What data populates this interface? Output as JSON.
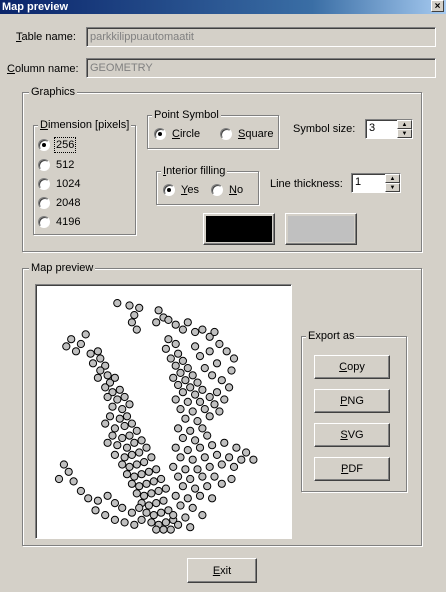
{
  "window": {
    "title": "Map preview",
    "close_glyph": "×"
  },
  "table": {
    "label_accel": "T",
    "label_rest": "able name:",
    "value": "parkkilippuautomaatit"
  },
  "column": {
    "label_accel": "C",
    "label_rest": "olumn name:",
    "value": "GEOMETRY"
  },
  "graphics": {
    "legend": "Graphics",
    "dimension": {
      "legend_accel": "D",
      "legend_rest": "imension [pixels]",
      "options": [
        {
          "label": "256",
          "checked": true
        },
        {
          "label": "512",
          "checked": false
        },
        {
          "label": "1024",
          "checked": false
        },
        {
          "label": "2048",
          "checked": false
        },
        {
          "label": "4196",
          "checked": false
        }
      ]
    },
    "point_symbol": {
      "legend": "Point Symbol",
      "options": [
        {
          "accel": "C",
          "rest": "ircle",
          "checked": true
        },
        {
          "accel": "S",
          "rest": "quare",
          "checked": false
        }
      ]
    },
    "symbol_size": {
      "label": "Symbol size:",
      "value": "3"
    },
    "interior_filling": {
      "legend_accel": "I",
      "legend_rest": "nterior filling",
      "options": [
        {
          "accel": "Y",
          "rest": "es",
          "checked": true
        },
        {
          "accel": "N",
          "rest": "o",
          "checked": false
        }
      ]
    },
    "line_thickness": {
      "label": "Line thickness:",
      "value": "1"
    },
    "colors": {
      "line_color": "#000000",
      "fill_color": "#c0c0c0"
    }
  },
  "preview": {
    "legend": "Map preview",
    "points": [
      [
        0.31,
        0.05
      ],
      [
        0.36,
        0.06
      ],
      [
        0.4,
        0.07
      ],
      [
        0.38,
        0.1
      ],
      [
        0.37,
        0.13
      ],
      [
        0.39,
        0.16
      ],
      [
        0.48,
        0.08
      ],
      [
        0.5,
        0.11
      ],
      [
        0.47,
        0.13
      ],
      [
        0.52,
        0.12
      ],
      [
        0.55,
        0.14
      ],
      [
        0.58,
        0.16
      ],
      [
        0.6,
        0.13
      ],
      [
        0.63,
        0.17
      ],
      [
        0.66,
        0.16
      ],
      [
        0.69,
        0.19
      ],
      [
        0.71,
        0.17
      ],
      [
        0.12,
        0.2
      ],
      [
        0.1,
        0.23
      ],
      [
        0.16,
        0.22
      ],
      [
        0.18,
        0.18
      ],
      [
        0.14,
        0.25
      ],
      [
        0.2,
        0.26
      ],
      [
        0.23,
        0.25
      ],
      [
        0.24,
        0.28
      ],
      [
        0.21,
        0.3
      ],
      [
        0.26,
        0.31
      ],
      [
        0.24,
        0.33
      ],
      [
        0.27,
        0.35
      ],
      [
        0.23,
        0.36
      ],
      [
        0.28,
        0.38
      ],
      [
        0.3,
        0.36
      ],
      [
        0.26,
        0.4
      ],
      [
        0.29,
        0.42
      ],
      [
        0.32,
        0.41
      ],
      [
        0.27,
        0.44
      ],
      [
        0.31,
        0.45
      ],
      [
        0.34,
        0.44
      ],
      [
        0.29,
        0.48
      ],
      [
        0.33,
        0.49
      ],
      [
        0.36,
        0.47
      ],
      [
        0.28,
        0.52
      ],
      [
        0.32,
        0.53
      ],
      [
        0.35,
        0.52
      ],
      [
        0.26,
        0.55
      ],
      [
        0.3,
        0.57
      ],
      [
        0.34,
        0.56
      ],
      [
        0.37,
        0.55
      ],
      [
        0.29,
        0.6
      ],
      [
        0.33,
        0.61
      ],
      [
        0.36,
        0.6
      ],
      [
        0.39,
        0.58
      ],
      [
        0.27,
        0.63
      ],
      [
        0.31,
        0.64
      ],
      [
        0.35,
        0.65
      ],
      [
        0.38,
        0.63
      ],
      [
        0.41,
        0.62
      ],
      [
        0.3,
        0.68
      ],
      [
        0.34,
        0.69
      ],
      [
        0.37,
        0.68
      ],
      [
        0.4,
        0.67
      ],
      [
        0.43,
        0.65
      ],
      [
        0.33,
        0.72
      ],
      [
        0.36,
        0.73
      ],
      [
        0.39,
        0.72
      ],
      [
        0.42,
        0.71
      ],
      [
        0.45,
        0.69
      ],
      [
        0.35,
        0.76
      ],
      [
        0.38,
        0.77
      ],
      [
        0.41,
        0.76
      ],
      [
        0.44,
        0.75
      ],
      [
        0.47,
        0.74
      ],
      [
        0.37,
        0.8
      ],
      [
        0.4,
        0.81
      ],
      [
        0.43,
        0.8
      ],
      [
        0.46,
        0.79
      ],
      [
        0.49,
        0.78
      ],
      [
        0.39,
        0.84
      ],
      [
        0.42,
        0.85
      ],
      [
        0.45,
        0.84
      ],
      [
        0.48,
        0.83
      ],
      [
        0.51,
        0.82
      ],
      [
        0.41,
        0.88
      ],
      [
        0.44,
        0.89
      ],
      [
        0.47,
        0.88
      ],
      [
        0.5,
        0.87
      ],
      [
        0.43,
        0.92
      ],
      [
        0.46,
        0.93
      ],
      [
        0.49,
        0.92
      ],
      [
        0.52,
        0.91
      ],
      [
        0.45,
        0.96
      ],
      [
        0.48,
        0.97
      ],
      [
        0.51,
        0.96
      ],
      [
        0.54,
        0.95
      ],
      [
        0.47,
        0.99
      ],
      [
        0.5,
        0.99
      ],
      [
        0.53,
        0.99
      ],
      [
        0.52,
        0.2
      ],
      [
        0.55,
        0.22
      ],
      [
        0.51,
        0.24
      ],
      [
        0.56,
        0.26
      ],
      [
        0.53,
        0.28
      ],
      [
        0.58,
        0.29
      ],
      [
        0.55,
        0.31
      ],
      [
        0.6,
        0.32
      ],
      [
        0.57,
        0.34
      ],
      [
        0.62,
        0.35
      ],
      [
        0.54,
        0.36
      ],
      [
        0.59,
        0.37
      ],
      [
        0.56,
        0.39
      ],
      [
        0.61,
        0.4
      ],
      [
        0.64,
        0.38
      ],
      [
        0.58,
        0.42
      ],
      [
        0.63,
        0.43
      ],
      [
        0.66,
        0.41
      ],
      [
        0.55,
        0.45
      ],
      [
        0.6,
        0.46
      ],
      [
        0.65,
        0.46
      ],
      [
        0.69,
        0.44
      ],
      [
        0.57,
        0.49
      ],
      [
        0.62,
        0.5
      ],
      [
        0.67,
        0.49
      ],
      [
        0.71,
        0.47
      ],
      [
        0.59,
        0.53
      ],
      [
        0.64,
        0.54
      ],
      [
        0.69,
        0.52
      ],
      [
        0.73,
        0.5
      ],
      [
        0.56,
        0.57
      ],
      [
        0.61,
        0.58
      ],
      [
        0.66,
        0.57
      ],
      [
        0.58,
        0.61
      ],
      [
        0.63,
        0.62
      ],
      [
        0.68,
        0.6
      ],
      [
        0.72,
        0.42
      ],
      [
        0.75,
        0.45
      ],
      [
        0.77,
        0.4
      ],
      [
        0.74,
        0.37
      ],
      [
        0.7,
        0.35
      ],
      [
        0.67,
        0.32
      ],
      [
        0.72,
        0.3
      ],
      [
        0.65,
        0.27
      ],
      [
        0.69,
        0.25
      ],
      [
        0.63,
        0.23
      ],
      [
        0.73,
        0.22
      ],
      [
        0.76,
        0.25
      ],
      [
        0.79,
        0.28
      ],
      [
        0.78,
        0.33
      ],
      [
        0.55,
        0.65
      ],
      [
        0.6,
        0.66
      ],
      [
        0.65,
        0.65
      ],
      [
        0.7,
        0.64
      ],
      [
        0.75,
        0.63
      ],
      [
        0.8,
        0.65
      ],
      [
        0.84,
        0.67
      ],
      [
        0.57,
        0.69
      ],
      [
        0.62,
        0.7
      ],
      [
        0.67,
        0.69
      ],
      [
        0.72,
        0.68
      ],
      [
        0.77,
        0.69
      ],
      [
        0.82,
        0.7
      ],
      [
        0.87,
        0.7
      ],
      [
        0.54,
        0.73
      ],
      [
        0.59,
        0.74
      ],
      [
        0.64,
        0.74
      ],
      [
        0.69,
        0.73
      ],
      [
        0.74,
        0.72
      ],
      [
        0.79,
        0.73
      ],
      [
        0.56,
        0.77
      ],
      [
        0.61,
        0.78
      ],
      [
        0.66,
        0.77
      ],
      [
        0.71,
        0.77
      ],
      [
        0.58,
        0.81
      ],
      [
        0.63,
        0.82
      ],
      [
        0.68,
        0.81
      ],
      [
        0.55,
        0.85
      ],
      [
        0.6,
        0.86
      ],
      [
        0.65,
        0.85
      ],
      [
        0.57,
        0.89
      ],
      [
        0.62,
        0.9
      ],
      [
        0.54,
        0.93
      ],
      [
        0.59,
        0.94
      ],
      [
        0.56,
        0.97
      ],
      [
        0.61,
        0.98
      ],
      [
        0.66,
        0.93
      ],
      [
        0.7,
        0.86
      ],
      [
        0.74,
        0.8
      ],
      [
        0.78,
        0.78
      ],
      [
        0.09,
        0.72
      ],
      [
        0.11,
        0.75
      ],
      [
        0.07,
        0.78
      ],
      [
        0.13,
        0.79
      ],
      [
        0.16,
        0.83
      ],
      [
        0.19,
        0.86
      ],
      [
        0.23,
        0.87
      ],
      [
        0.27,
        0.85
      ],
      [
        0.3,
        0.88
      ],
      [
        0.33,
        0.9
      ],
      [
        0.22,
        0.91
      ],
      [
        0.26,
        0.93
      ],
      [
        0.3,
        0.95
      ],
      [
        0.34,
        0.96
      ],
      [
        0.38,
        0.97
      ],
      [
        0.41,
        0.95
      ],
      [
        0.37,
        0.92
      ],
      [
        0.4,
        0.9
      ]
    ]
  },
  "export": {
    "legend": "Export as",
    "buttons": [
      {
        "accel": "C",
        "rest": "opy"
      },
      {
        "accel": "P",
        "rest": "NG"
      },
      {
        "accel": "S",
        "rest": "VG"
      },
      {
        "accel": "P",
        "rest": "DF"
      }
    ]
  },
  "exit": {
    "accel": "E",
    "rest": "xit"
  }
}
